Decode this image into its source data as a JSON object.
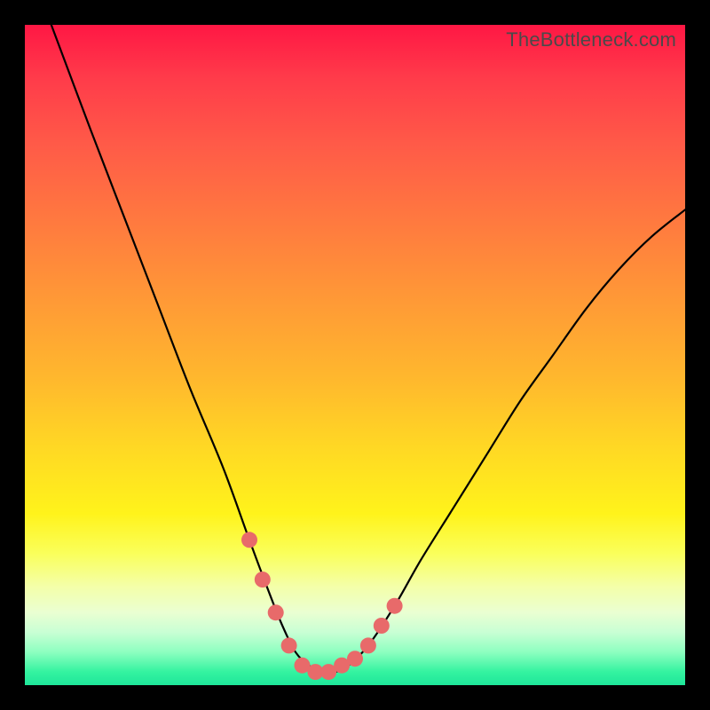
{
  "watermark": "TheBottleneck.com",
  "colors": {
    "frame": "#000000",
    "curve": "#000000",
    "marker": "#e86a6a",
    "gradient_top": "#ff1744",
    "gradient_bottom": "#1ee69a"
  },
  "chart_data": {
    "type": "line",
    "title": "",
    "xlabel": "",
    "ylabel": "",
    "xlim": [
      0,
      100
    ],
    "ylim": [
      0,
      100
    ],
    "annotations": [],
    "series": [
      {
        "name": "bottleneck-curve",
        "x": [
          4,
          10,
          15,
          20,
          25,
          30,
          34,
          37,
          39,
          41,
          43,
          45,
          47,
          49,
          52,
          56,
          60,
          65,
          70,
          75,
          80,
          85,
          90,
          95,
          100
        ],
        "y": [
          100,
          84,
          71,
          58,
          45,
          33,
          22,
          14,
          9,
          5,
          3,
          2,
          2,
          3,
          6,
          12,
          19,
          27,
          35,
          43,
          50,
          57,
          63,
          68,
          72
        ]
      }
    ],
    "markers": {
      "name": "highlighted-region",
      "x": [
        34,
        36,
        38,
        40,
        42,
        44,
        46,
        48,
        50,
        52,
        54,
        56
      ],
      "y": [
        22,
        16,
        11,
        6,
        3,
        2,
        2,
        3,
        4,
        6,
        9,
        12
      ]
    }
  }
}
